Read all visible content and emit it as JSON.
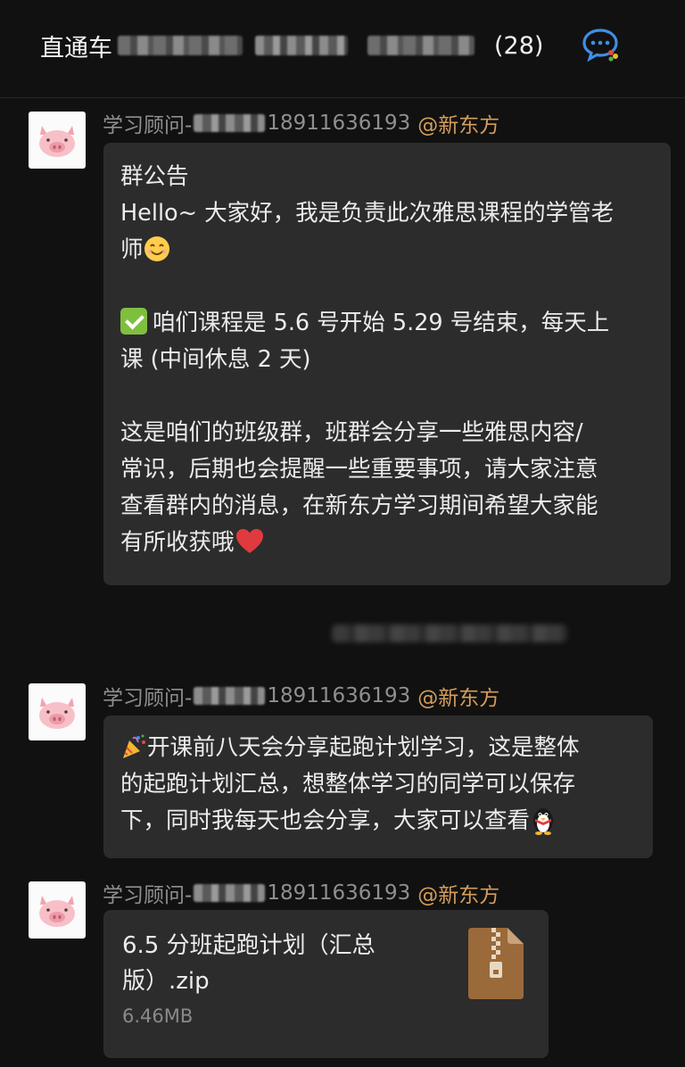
{
  "header": {
    "title_prefix": "直通车",
    "member_count": "(28)"
  },
  "messages": [
    {
      "sender_prefix": "学习顾问-",
      "sender_phone": "18911636193",
      "sender_org": "@新东方",
      "lines": [
        "群公告",
        "Hello~ 大家好，我是负责此次雅思课程的学管老",
        "师",
        "咱们课程是 5.6 号开始 5.29 号结束，每天上",
        "课 (中间休息 2 天)",
        "这是咱们的班级群，班群会分享一些雅思内容/",
        "常识，后期也会提醒一些重要事项，请大家注意",
        "查看群内的消息，在新东方学习期间希望大家能",
        "有所收获哦"
      ]
    },
    {
      "sender_prefix": "学习顾问-",
      "sender_phone": "18911636193",
      "sender_org": "@新东方",
      "lines": [
        "开课前八天会分享起跑计划学习，这是整体",
        "的起跑计划汇总，想整体学习的同学可以保存",
        "下，同时我每天也会分享，大家可以查看"
      ]
    },
    {
      "sender_prefix": "学习顾问-",
      "sender_phone": "18911636193",
      "sender_org": "@新东方",
      "file": {
        "name_line1": "6.5 分班起跑计划（汇总",
        "name_line2": "版）.zip",
        "size": "6.46MB",
        "icon": "zip-file-icon"
      }
    }
  ],
  "colors": {
    "background": "#111111",
    "bubble": "#2c2c2c",
    "org_accent": "#d59d5b",
    "muted": "#8f8f8f"
  }
}
